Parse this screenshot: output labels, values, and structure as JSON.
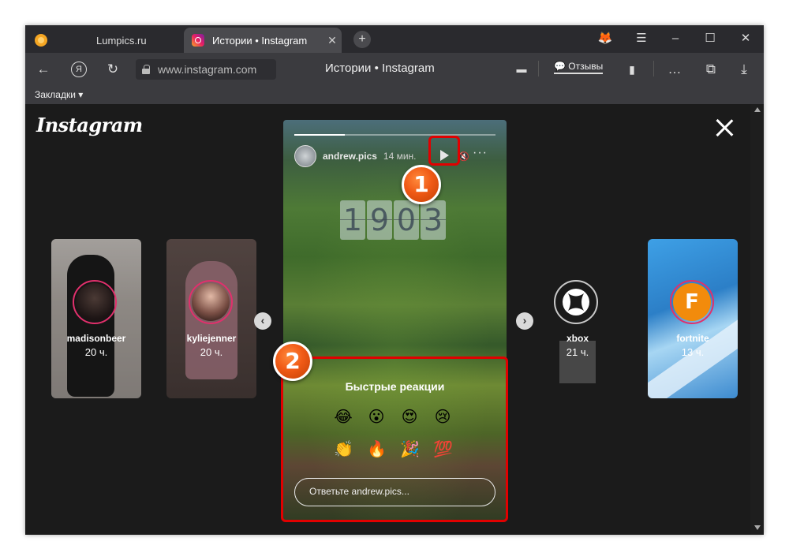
{
  "tabs": [
    {
      "label": "Lumpics.ru"
    },
    {
      "label": "Истории • Instagram"
    }
  ],
  "toolbar": {
    "url": "www.instagram.com",
    "page_title": "Истории • Instagram",
    "feedback_label": "Отзывы",
    "bookmarks_label": "Закладки ▾"
  },
  "instagram": {
    "logo": "Instagram"
  },
  "side_stories": [
    {
      "name": "madisonbeer",
      "time": "20 ч."
    },
    {
      "name": "kyliejenner",
      "time": "20 ч."
    },
    {
      "name": "xbox",
      "time": "21 ч."
    },
    {
      "name": "fortnite",
      "time": "13 ч."
    }
  ],
  "story": {
    "user": "andrew.pics",
    "time": "14 мин.",
    "progress": 0.25,
    "clock_digits": [
      "1",
      "9",
      "0",
      "3"
    ]
  },
  "reactions": {
    "title": "Быстрые реакции",
    "row1": [
      "😂",
      "😮",
      "😍",
      "😢"
    ],
    "row2": [
      "👏",
      "🔥",
      "🎉",
      "💯"
    ],
    "reply_placeholder": "Ответьте andrew.pics..."
  },
  "badges": [
    "1",
    "2"
  ],
  "colors": {
    "highlight": "#e10000",
    "badge": "#f05a16",
    "story_ring": "#e1306c"
  }
}
